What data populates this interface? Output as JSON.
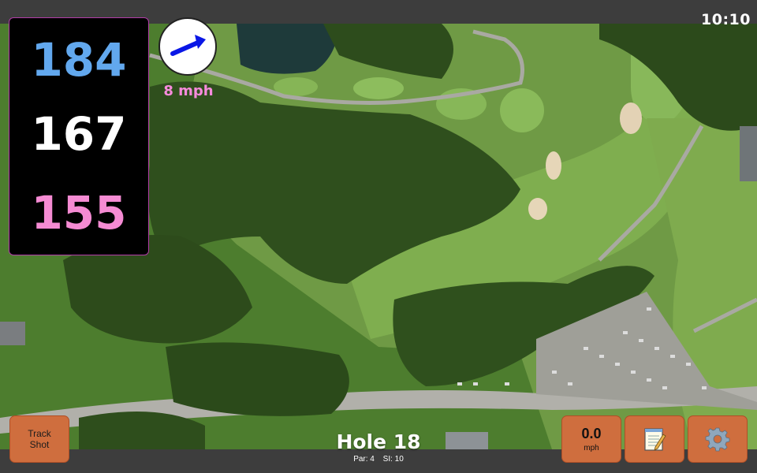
{
  "status": {
    "time": "10:10"
  },
  "distances": {
    "back": "184",
    "middle": "167",
    "front": "155"
  },
  "colors": {
    "back": "#62a8ee",
    "middle": "#ffffff",
    "front": "#f58bd3",
    "button": "#cf6e3e",
    "wind_text": "#f78bdc"
  },
  "wind": {
    "speed": "8 mph",
    "direction_icon": "arrow-right-up"
  },
  "hole": {
    "title": "Hole 18",
    "par": "Par: 4",
    "si": "SI: 10"
  },
  "buttons": {
    "track_shot": "Track\nShot",
    "speed_value": "0.0",
    "speed_unit": "mph",
    "notes_icon": "notepad-icon",
    "settings_icon": "gear-icon"
  }
}
